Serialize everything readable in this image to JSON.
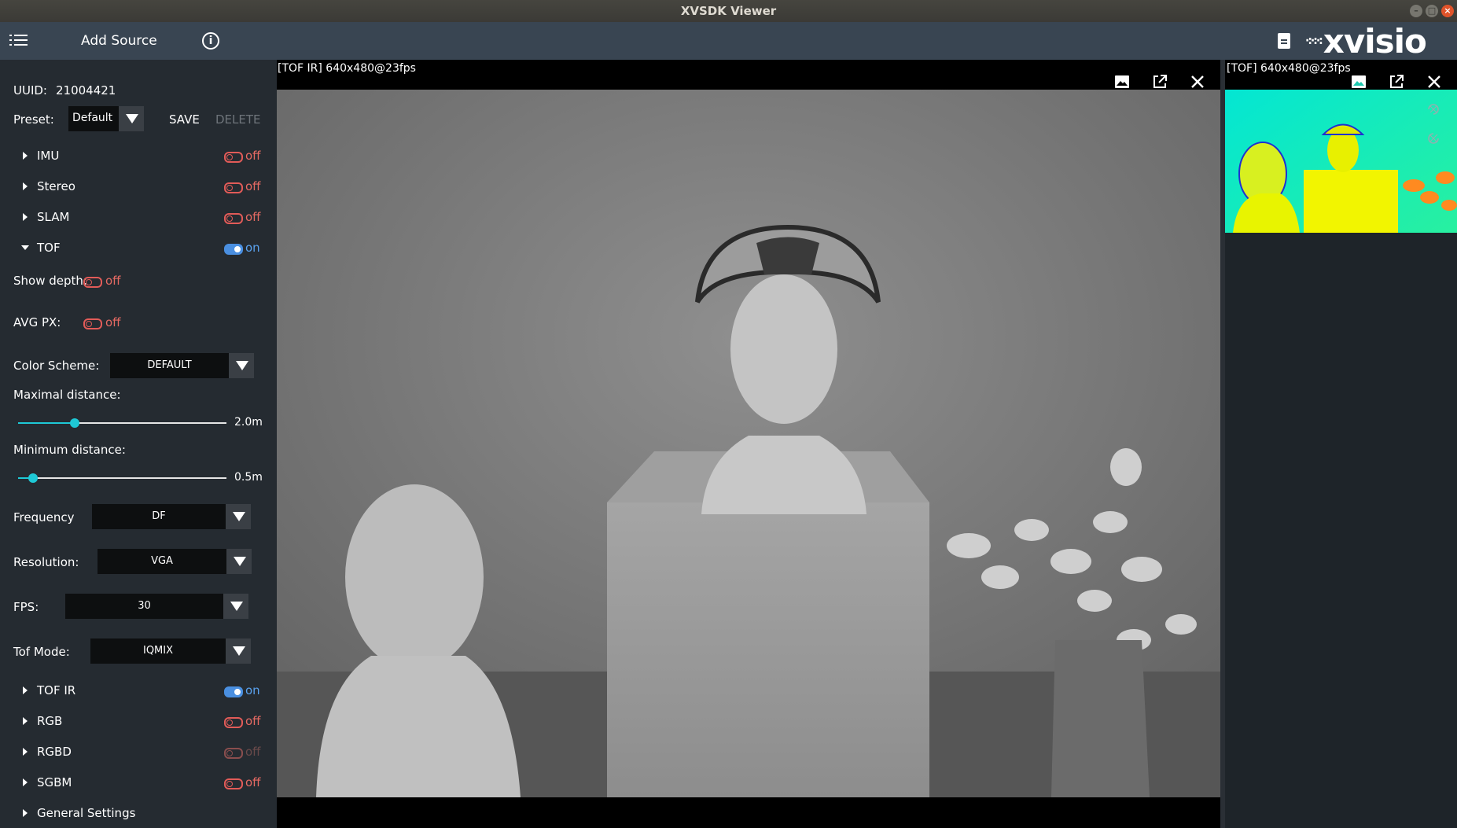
{
  "window": {
    "title": "XVSDK Viewer"
  },
  "toolbar": {
    "add_source": "Add Source",
    "logo_text": "xvisio",
    "logo_dots": "·:·:·:"
  },
  "sidebar": {
    "uuid_label": "UUID:",
    "uuid_value": "21004421",
    "preset_label": "Preset:",
    "preset_value": "Default",
    "save_label": "SAVE",
    "delete_label": "DELETE",
    "sections_top": [
      {
        "name": "IMU",
        "state": "off"
      },
      {
        "name": "Stereo",
        "state": "off"
      },
      {
        "name": "SLAM",
        "state": "off"
      },
      {
        "name": "TOF",
        "state": "on"
      }
    ],
    "tof": {
      "show_depth_label": "Show depth:",
      "show_depth_state": "off",
      "avg_px_label": "AVG PX:",
      "avg_px_state": "off",
      "color_scheme_label": "Color Scheme:",
      "color_scheme_value": "DEFAULT",
      "max_distance_label": "Maximal distance:",
      "max_distance_value": "2.0m",
      "max_distance_fraction": 0.27,
      "min_distance_label": "Minimum distance:",
      "min_distance_value": "0.5m",
      "min_distance_fraction": 0.07,
      "frequency_label": "Frequency",
      "frequency_value": "DF",
      "resolution_label": "Resolution:",
      "resolution_value": "VGA",
      "fps_label": "FPS:",
      "fps_value": "30",
      "tof_mode_label": "Tof Mode:",
      "tof_mode_value": "IQMIX"
    },
    "sections_bottom": [
      {
        "name": "TOF IR",
        "state": "on"
      },
      {
        "name": "RGB",
        "state": "off"
      },
      {
        "name": "RGBD",
        "state": "off"
      },
      {
        "name": "SGBM",
        "state": "off"
      },
      {
        "name": "General Settings",
        "state": ""
      }
    ]
  },
  "main_view": {
    "label": "[TOF IR]  640x480@23fps"
  },
  "side_view": {
    "label": "[TOF]  640x480@23fps"
  },
  "colors": {
    "toolbar": "#394552",
    "sidebar": "#252b31",
    "accent_on": "#4a8fe0",
    "accent_off": "#e25b58",
    "slider": "#1ec9d6"
  }
}
